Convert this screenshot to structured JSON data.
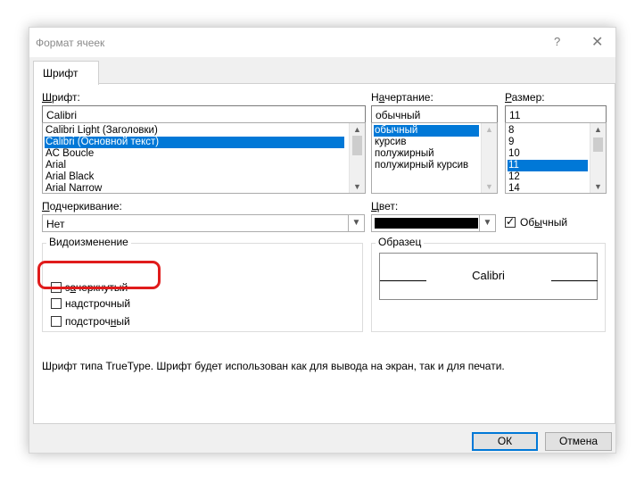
{
  "window": {
    "title": "Формат ячеек",
    "help_glyph": "?",
    "close_glyph": "✕"
  },
  "tabs": [
    {
      "label": "Шрифт",
      "active": true
    }
  ],
  "font": {
    "label_underlined": "Ш",
    "label_rest": "рифт:",
    "value": "Calibri",
    "options": [
      "Calibri Light (Заголовки)",
      "Calibri (Основной текст)",
      "AC Boucle",
      "Arial",
      "Arial Black",
      "Arial Narrow"
    ],
    "selected_index": 1
  },
  "style": {
    "label_before": "Н",
    "label_underlined": "а",
    "label_rest": "чертание:",
    "value": "обычный",
    "options": [
      "обычный",
      "курсив",
      "полужирный",
      "полужирный курсив"
    ],
    "selected_index": 0
  },
  "size": {
    "label_underlined": "Р",
    "label_rest": "азмер:",
    "value": "11",
    "options": [
      "8",
      "9",
      "10",
      "11",
      "12",
      "14"
    ],
    "selected_index": 3
  },
  "underline": {
    "label_underlined": "П",
    "label_rest": "одчеркивание:",
    "value": "Нет"
  },
  "color": {
    "label_underlined": "Ц",
    "label_rest": "вет:",
    "swatch": "#000000",
    "normal_checkbox": {
      "label_before": "Об",
      "label_underlined": "ы",
      "label_rest": "чный",
      "checked": true
    }
  },
  "effects": {
    "title": "Видоизменение",
    "items": [
      {
        "label_before": "з",
        "label_underlined": "а",
        "label_rest": "черкнутый",
        "checked": false
      },
      {
        "label_before": "на",
        "label_underlined": "д",
        "label_rest": "строчный",
        "checked": false
      },
      {
        "label_before": "подстроч",
        "label_underlined": "н",
        "label_rest": "ый",
        "checked": false
      }
    ]
  },
  "preview": {
    "title": "Образец",
    "sample_text": "Calibri"
  },
  "info_text": "Шрифт типа TrueType. Шрифт будет использован как для вывода на экран, так и для печати.",
  "buttons": {
    "ok": "ОК",
    "cancel": "Отмена"
  },
  "annotation": {
    "color": "#e01b1b"
  },
  "colors": {
    "selection": "#0078d7",
    "dialog_bg": "#f0f0f0"
  }
}
